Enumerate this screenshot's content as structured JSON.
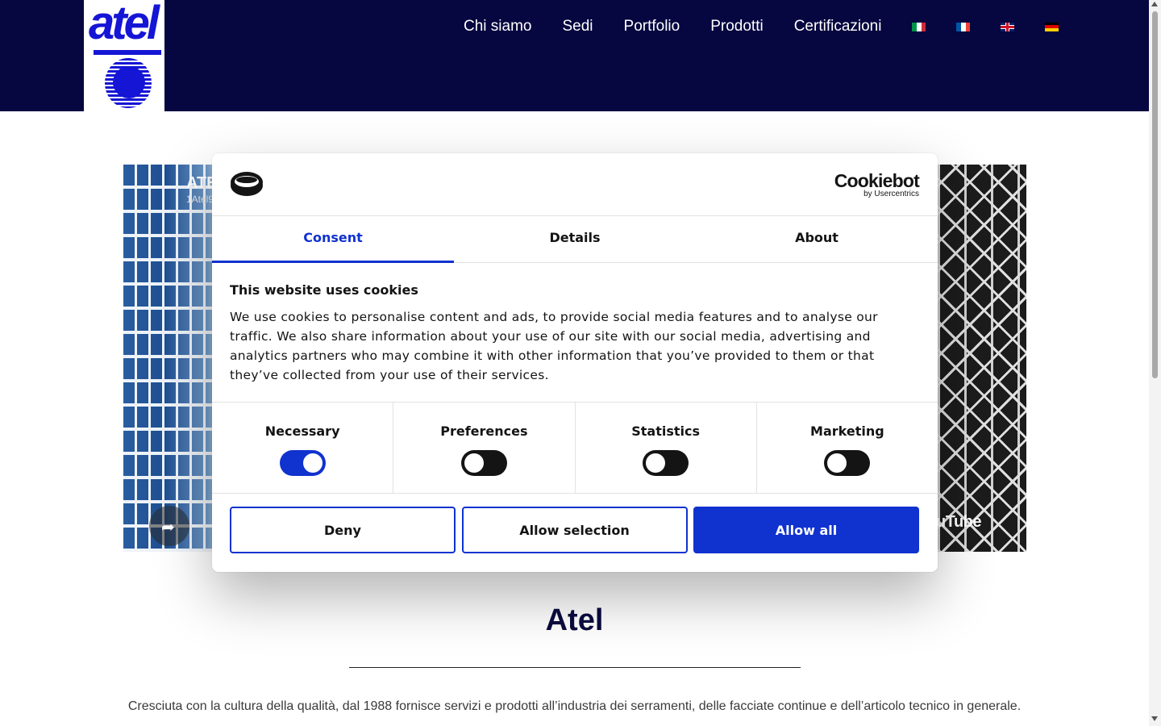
{
  "header": {
    "logo_text": "atel",
    "nav": [
      "Chi siamo",
      "Sedi",
      "Portfolio",
      "Prodotti",
      "Certificazioni"
    ],
    "languages": [
      "it-flag-icon",
      "fr-flag-icon",
      "uk-flag-icon",
      "de-flag-icon"
    ]
  },
  "video": {
    "title": "ATE",
    "subtitle": "1Atel9",
    "youtube_label": "YouTube",
    "share_icon": "share-icon"
  },
  "cookie_dialog": {
    "brand_name": "Cookiebot",
    "brand_by": "by Usercentrics",
    "tabs": [
      "Consent",
      "Details",
      "About"
    ],
    "active_tab": "Consent",
    "title": "This website uses cookies",
    "text": "We use cookies to personalise content and ads, to provide social media features and to analyse our traffic. We also share information about your use of our site with our social media, advertising and analytics partners who may combine it with other information that you’ve provided to them or that they’ve collected from your use of their services.",
    "toggles": [
      {
        "label": "Necessary",
        "on": true
      },
      {
        "label": "Preferences",
        "on": false
      },
      {
        "label": "Statistics",
        "on": false
      },
      {
        "label": "Marketing",
        "on": false
      }
    ],
    "buttons": {
      "deny": "Deny",
      "allow_selection": "Allow selection",
      "allow_all": "Allow all"
    }
  },
  "page": {
    "title": "Atel",
    "intro": "Cresciuta con la cultura della qualità, dal 1988 fornisce servizi e prodotti all’industria dei serramenti, delle facciate continue e dell’articolo tecnico in generale."
  },
  "colors": {
    "header_bg": "#060640",
    "accent": "#1032cf",
    "logo_blue": "#1515d6"
  }
}
